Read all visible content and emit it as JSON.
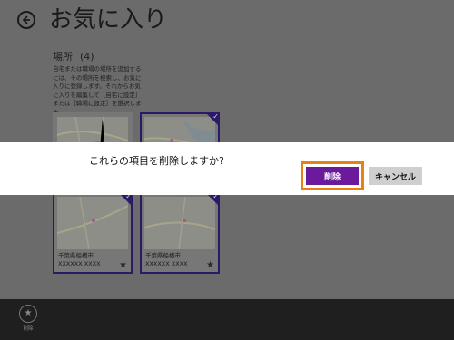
{
  "page": {
    "title": "お気に入り",
    "back_icon": "back-arrow-icon"
  },
  "section": {
    "heading": "場所",
    "count": "(4)",
    "help_text": "自宅または職場の場所を追加するには、その場所を検索し、お気に入りに登録します。それからお気に入りを編集して［自宅に設定］または［職場に設定］を選択します。"
  },
  "tiles": [
    {
      "caption": "",
      "selected": false
    },
    {
      "caption": "",
      "selected": true
    },
    {
      "caption": "千葉県船橋市XXXXXX XXXX",
      "selected": true
    },
    {
      "caption": "千葉県船橋市XXXXXX XXXX",
      "selected": true
    }
  ],
  "dialog": {
    "message": "これらの項目を削除しますか?",
    "delete_label": "削除",
    "cancel_label": "キャンセル",
    "delete_color": "#6a1a9a",
    "highlight_color": "#e8810f"
  },
  "app_bar": {
    "delete_label": "削除",
    "delete_icon": "star-remove-icon"
  }
}
